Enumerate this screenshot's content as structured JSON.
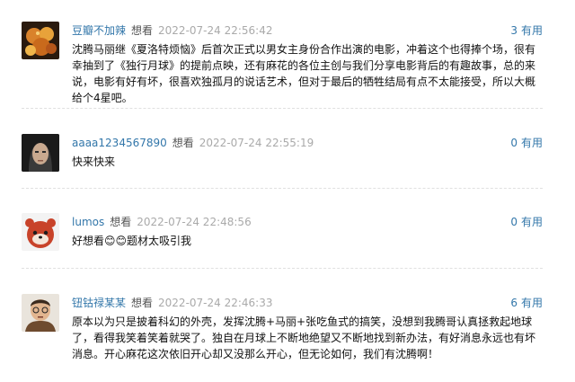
{
  "comments": [
    {
      "user": "豆瓣不加辣",
      "status": "想看",
      "time": "2022-07-24 22:56:42",
      "votes": "3",
      "vote_label": "有用",
      "avatar": "food-avatar",
      "content": "沈腾马丽继《夏洛特烦恼》后首次正式以男女主身份合作出演的电影，冲着这个也得捧个场，很有幸抽到了《独行月球》的提前点映，还有麻花的各位主创与我们分享电影背后的有趣故事，总的来说，电影有好有坏，很喜欢独孤月的说话艺术，但对于最后的牺牲结局有点不太能接受，所以大概给个4星吧。"
    },
    {
      "user": "aaaa1234567890",
      "status": "想看",
      "time": "2022-07-24 22:55:19",
      "votes": "0",
      "vote_label": "有用",
      "avatar": "portrait-avatar",
      "content": "快来快来"
    },
    {
      "user": "lumos",
      "status": "想看",
      "time": "2022-07-24 22:48:56",
      "votes": "0",
      "vote_label": "有用",
      "avatar": "red-panda-avatar",
      "content": "好想看😊😊题材太吸引我"
    },
    {
      "user": "钮钴禄某某",
      "status": "想看",
      "time": "2022-07-24 22:46:33",
      "votes": "6",
      "vote_label": "有用",
      "avatar": "cartoon-man-avatar",
      "content": "原本以为只是披着科幻的外壳，发挥沈腾+马丽+张吃鱼式的搞笑，没想到我腾哥认真拯救起地球了，看得我笑着笑着就哭了。独自在月球上不断地绝望又不断地找到新办法，有好消息永远也有坏消息。开心麻花这次依旧开心却又没那么开心，但无论如何，我们有沈腾啊！"
    }
  ]
}
